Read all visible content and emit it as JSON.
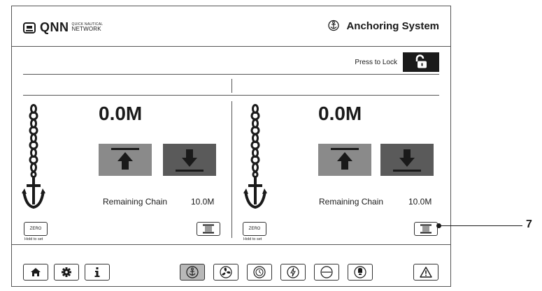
{
  "header": {
    "brand": "QNN",
    "brand_sub_1": "QUICK NAUTICAL",
    "brand_sub_2": "NETWORK",
    "title": "Anchoring System"
  },
  "lock": {
    "label": "Press to Lock"
  },
  "windlass": [
    {
      "depth": "0.0M",
      "remaining_label": "Remaining Chain",
      "remaining_value": "10.0M",
      "zero_label": "ZERO",
      "hold_label": "Hold to set"
    },
    {
      "depth": "0.0M",
      "remaining_label": "Remaining Chain",
      "remaining_value": "10.0M",
      "zero_label": "ZERO",
      "hold_label": "Hold to set"
    }
  ],
  "callout": {
    "number": "7"
  },
  "icons": {
    "brand": "qnn-logo-icon",
    "title": "anchor-icon",
    "lock": "unlocked-padlock-icon",
    "chain": "anchor-chain-icon",
    "up": "chain-up-arrow-icon",
    "down": "chain-down-arrow-icon",
    "reel": "chain-reel-icon",
    "footer": [
      "home-icon",
      "settings-icon",
      "info-icon",
      "anchor-icon",
      "fan-icon",
      "clock-icon",
      "power-icon",
      "circle-minus-icon",
      "bulb-icon",
      "warning-icon"
    ]
  },
  "colors": {
    "up_button": "#8a8a8a",
    "down_button": "#5a5a5a",
    "lock_button": "#1a1a1a",
    "active_tab": "#b8b8b8"
  }
}
